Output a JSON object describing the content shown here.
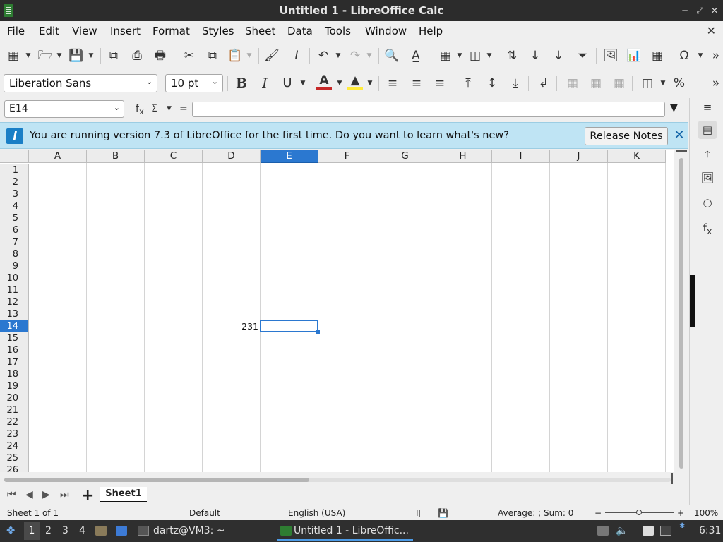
{
  "window": {
    "title": "Untitled 1 - LibreOffice Calc"
  },
  "menu": [
    "File",
    "Edit",
    "View",
    "Insert",
    "Format",
    "Styles",
    "Sheet",
    "Data",
    "Tools",
    "Window",
    "Help"
  ],
  "format_toolbar": {
    "font_name": "Liberation Sans",
    "font_size": "10 pt",
    "font_color": "#c62828",
    "highlight_color": "#ffeb3b"
  },
  "formula_bar": {
    "name_box": "E14",
    "content": ""
  },
  "infobar": {
    "message": "You are running version 7.3 of LibreOffice for the first time. Do you want to learn what's new?",
    "button": "Release Notes"
  },
  "sheet": {
    "columns": [
      "A",
      "B",
      "C",
      "D",
      "E",
      "F",
      "G",
      "H",
      "I",
      "J",
      "K"
    ],
    "rows": [
      "1",
      "2",
      "3",
      "4",
      "5",
      "6",
      "7",
      "8",
      "9",
      "10",
      "11",
      "12",
      "13",
      "14",
      "15",
      "16",
      "17",
      "18",
      "19",
      "20",
      "21",
      "22",
      "23",
      "24",
      "25",
      "26"
    ],
    "selected_column": "E",
    "selected_row": "14",
    "cells": {
      "D14": "231"
    },
    "tabs": [
      "Sheet1"
    ]
  },
  "statusbar": {
    "sheet_pos": "Sheet 1 of 1",
    "page_style": "Default",
    "language": "English (USA)",
    "sum": "Average: ; Sum: 0",
    "zoom": "100%"
  },
  "taskbar": {
    "workspaces": [
      "1",
      "2",
      "3",
      "4"
    ],
    "terminal": "dartz@VM3: ~",
    "calc": "Untitled 1 - LibreOffic...",
    "clock": "6:31"
  }
}
